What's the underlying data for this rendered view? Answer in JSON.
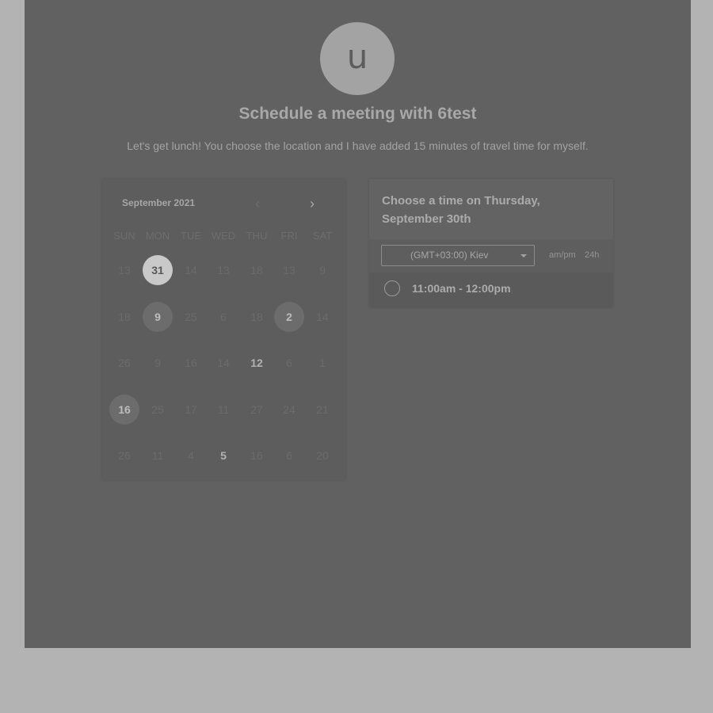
{
  "header": {
    "avatar_letter": "u",
    "title": "Schedule a meeting with 6test",
    "description": "Let's get lunch! You choose the location and I have added 15 minutes of travel time for myself."
  },
  "calendar": {
    "month": "September 2021",
    "prev_icon": "chevron-left-icon",
    "next_icon": "chevron-right-icon",
    "weekdays": [
      "SUN",
      "MON",
      "TUE",
      "WED",
      "THU",
      "FRI",
      "SAT"
    ],
    "weeks": [
      [
        {
          "label": "13",
          "state": "unavailable"
        },
        {
          "label": "31",
          "state": "selected"
        },
        {
          "label": "14",
          "state": "unavailable"
        },
        {
          "label": "13",
          "state": "unavailable"
        },
        {
          "label": "18",
          "state": "unavailable"
        },
        {
          "label": "13",
          "state": "unavailable"
        },
        {
          "label": "9",
          "state": "unavailable"
        }
      ],
      [
        {
          "label": "18",
          "state": "unavailable"
        },
        {
          "label": "9",
          "state": "circled"
        },
        {
          "label": "25",
          "state": "unavailable"
        },
        {
          "label": "6",
          "state": "unavailable"
        },
        {
          "label": "18",
          "state": "unavailable"
        },
        {
          "label": "2",
          "state": "circled"
        },
        {
          "label": "14",
          "state": "unavailable"
        }
      ],
      [
        {
          "label": "26",
          "state": "unavailable"
        },
        {
          "label": "9",
          "state": "unavailable"
        },
        {
          "label": "16",
          "state": "unavailable"
        },
        {
          "label": "14",
          "state": "unavailable"
        },
        {
          "label": "12",
          "state": "available"
        },
        {
          "label": "6",
          "state": "unavailable"
        },
        {
          "label": "1",
          "state": "unavailable"
        }
      ],
      [
        {
          "label": "16",
          "state": "circled"
        },
        {
          "label": "25",
          "state": "unavailable"
        },
        {
          "label": "17",
          "state": "unavailable"
        },
        {
          "label": "11",
          "state": "unavailable"
        },
        {
          "label": "27",
          "state": "unavailable"
        },
        {
          "label": "24",
          "state": "unavailable"
        },
        {
          "label": "21",
          "state": "unavailable"
        }
      ],
      [
        {
          "label": "26",
          "state": "unavailable"
        },
        {
          "label": "11",
          "state": "unavailable"
        },
        {
          "label": "4",
          "state": "unavailable"
        },
        {
          "label": "5",
          "state": "available"
        },
        {
          "label": "16",
          "state": "unavailable"
        },
        {
          "label": "6",
          "state": "unavailable"
        },
        {
          "label": "20",
          "state": "unavailable"
        }
      ]
    ]
  },
  "timepanel": {
    "title": "Choose a time on Thursday, September 30th",
    "timezone": "(GMT+03:00) Kiev",
    "format_ampm": "am/pm",
    "format_24h": "24h",
    "slots": [
      "11:00am - 12:00pm"
    ]
  }
}
